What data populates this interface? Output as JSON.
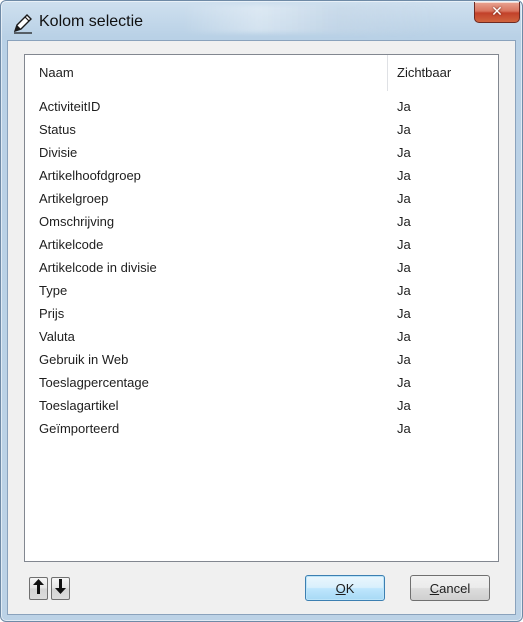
{
  "window": {
    "title": "Kolom selectie",
    "close_glyph": "✕",
    "title_icon": "edit-pencil-icon"
  },
  "list": {
    "headers": [
      "Naam",
      "Zichtbaar"
    ],
    "rows": [
      {
        "naam": "ActiviteitID",
        "zichtbaar": "Ja"
      },
      {
        "naam": "Status",
        "zichtbaar": "Ja"
      },
      {
        "naam": "Divisie",
        "zichtbaar": "Ja"
      },
      {
        "naam": "Artikelhoofdgroep",
        "zichtbaar": "Ja"
      },
      {
        "naam": "Artikelgroep",
        "zichtbaar": "Ja"
      },
      {
        "naam": "Omschrijving",
        "zichtbaar": "Ja"
      },
      {
        "naam": "Artikelcode",
        "zichtbaar": "Ja"
      },
      {
        "naam": "Artikelcode in divisie",
        "zichtbaar": "Ja"
      },
      {
        "naam": "Type",
        "zichtbaar": "Ja"
      },
      {
        "naam": "Prijs",
        "zichtbaar": "Ja"
      },
      {
        "naam": "Valuta",
        "zichtbaar": "Ja"
      },
      {
        "naam": "Gebruik in Web",
        "zichtbaar": "Ja"
      },
      {
        "naam": "Toeslagpercentage",
        "zichtbaar": "Ja"
      },
      {
        "naam": "Toeslagartikel",
        "zichtbaar": "Ja"
      },
      {
        "naam": "Geïmporteerd",
        "zichtbaar": "Ja"
      }
    ]
  },
  "buttons": {
    "move_up_icon": "arrow-up-icon",
    "move_down_icon": "arrow-down-icon",
    "ok_mnemonic": "O",
    "ok_rest": "K",
    "cancel_mnemonic": "C",
    "cancel_rest": "ancel"
  },
  "colors": {
    "close_button": "#c2412a",
    "frame": "#b9d1e6",
    "default_button_border": "#3c7fb1"
  }
}
